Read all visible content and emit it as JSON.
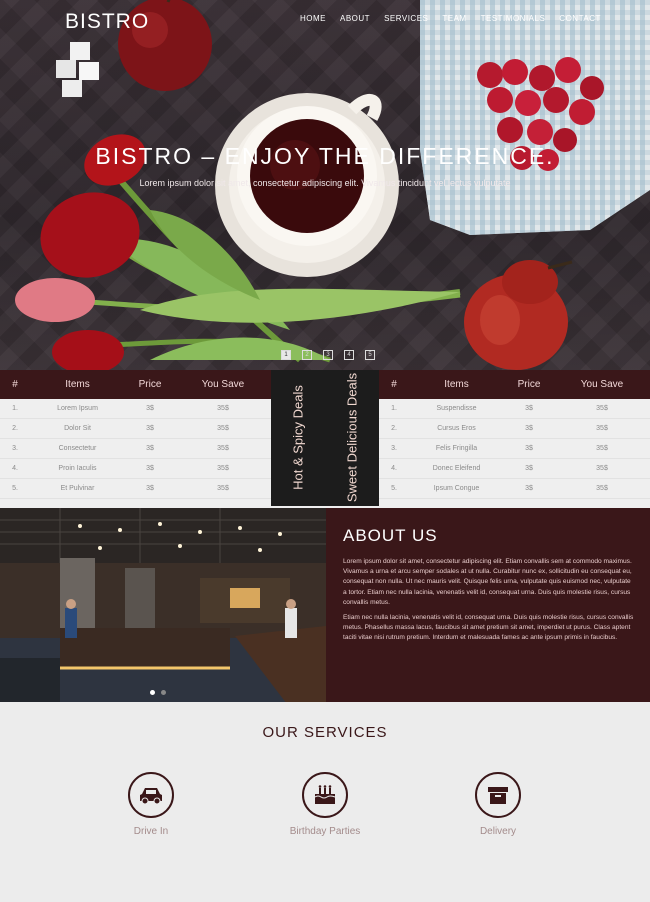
{
  "header": {
    "logo": "BISTRO",
    "nav": [
      "HOME",
      "ABOUT",
      "SERVICES",
      "TEAM",
      "TESTIMONIALS",
      "CONTACT"
    ]
  },
  "hero": {
    "title": "BISTRO – ENJOY THE DIFFERENCE.",
    "subtitle": "Lorem ipsum dolor sit amet, consectetur adipiscing elit. Vivamus tincidunt vel lectus vulputate",
    "pager": [
      "1",
      "2",
      "3",
      "4",
      "5"
    ],
    "active_page": 1
  },
  "deals": {
    "left": {
      "headers": [
        "#",
        "Items",
        "Price",
        "You Save"
      ],
      "rows": [
        [
          "1.",
          "Lorem Ipsum",
          "3$",
          "35$"
        ],
        [
          "2.",
          "Dolor Sit",
          "3$",
          "35$"
        ],
        [
          "3.",
          "Consectetur",
          "3$",
          "35$"
        ],
        [
          "4.",
          "Proin Iaculis",
          "3$",
          "35$"
        ],
        [
          "5.",
          "Et Pulvinar",
          "3$",
          "35$"
        ]
      ]
    },
    "right": {
      "headers": [
        "#",
        "Items",
        "Price",
        "You Save"
      ],
      "rows": [
        [
          "1.",
          "Suspendisse",
          "3$",
          "35$"
        ],
        [
          "2.",
          "Cursus Eros",
          "3$",
          "35$"
        ],
        [
          "3.",
          "Felis Fringilla",
          "3$",
          "35$"
        ],
        [
          "4.",
          "Donec Eleifend",
          "3$",
          "35$"
        ],
        [
          "5.",
          "Ipsum Congue",
          "3$",
          "35$"
        ]
      ]
    },
    "hot_label": "Hot & Spicy Deals",
    "sweet_label": "Sweet Delicious Deals"
  },
  "about": {
    "title": "ABOUT US",
    "paragraph1": "Lorem ipsum dolor sit amet, consectetur adipiscing elit. Etiam convallis sem at commodo maximus. Vivamus a urna et arcu semper sodales at ut nulla. Curabitur nunc ex, sollicitudin eu consequat eu, consequat non nulla. Ut nec mauris velit. Quisque felis urna, vulputate quis euismod nec, vulputate a tortor. Etiam nec nulla lacinia, venenatis velit id, consequat urna. Duis quis molestie risus, cursus convallis metus.",
    "paragraph2": "Etiam nec nulla lacinia, venenatis velit id, consequat urna. Duis quis molestie risus, cursus convallis metus. Phasellus massa lacus, faucibus sit amet pretium sit amet, imperdiet ut purus. Class aptent taciti vitae nisi rutrum pretium. Interdum et malesuada fames ac ante ipsum primis in faucibus.",
    "photo_slides": 2,
    "active_slide": 1
  },
  "services": {
    "title": "OUR SERVICES",
    "items": [
      {
        "label": "Drive In",
        "icon": "car-icon"
      },
      {
        "label": "Birthday Parties",
        "icon": "cake-icon"
      },
      {
        "label": "Delivery",
        "icon": "box-icon"
      }
    ]
  },
  "colors": {
    "brand_dark": "#3a1719",
    "panel_black": "#1c1c1c",
    "page_bg": "#ececec"
  }
}
